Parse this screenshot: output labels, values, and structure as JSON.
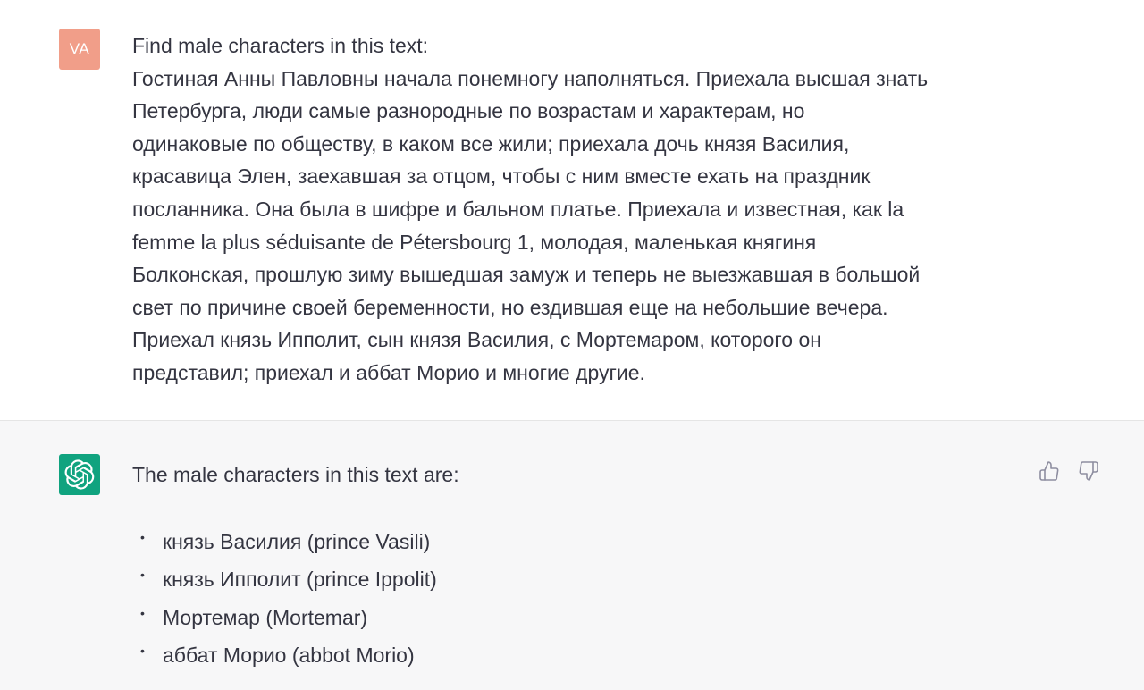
{
  "user_message": {
    "avatar_initials": "VA",
    "avatar_color": "#f19e89",
    "lines": [
      "Find male characters in this text:",
      "Гостиная Анны Павловны начала понемногу наполняться. Приехала высшая знать",
      "Петербурга, люди самые разнородные по возрастам и характерам, но",
      "одинаковые по обществу, в каком все жили; приехала дочь князя Василия,",
      "красавица Элен, заехавшая за отцом, чтобы с ним вместе ехать на праздник",
      "посланника. Она была в шифре и бальном платье. Приехала и известная, как la",
      "femme la plus séduisante de Pétersbourg 1, молодая, маленькая княгиня",
      "Болконская, прошлую зиму вышедшая замуж и теперь не выезжавшая в большой",
      "свет по причине своей беременности, но ездившая еще на небольшие вечера.",
      "Приехал князь Ипполит, сын князя Василия, с Мортемаром, которого он",
      "представил; приехал и аббат Морио и многие другие."
    ]
  },
  "assistant_message": {
    "avatar_icon": "openai-logo-icon",
    "avatar_color": "#10a37f",
    "intro": "The male characters in this text are:",
    "items": [
      "князь Василия (prince Vasili)",
      "князь Ипполит (prince Ippolit)",
      "Мортемар (Mortemar)",
      "аббат Морио (abbot Morio)"
    ],
    "feedback_icons": [
      "thumbs-up-icon",
      "thumbs-down-icon"
    ]
  }
}
